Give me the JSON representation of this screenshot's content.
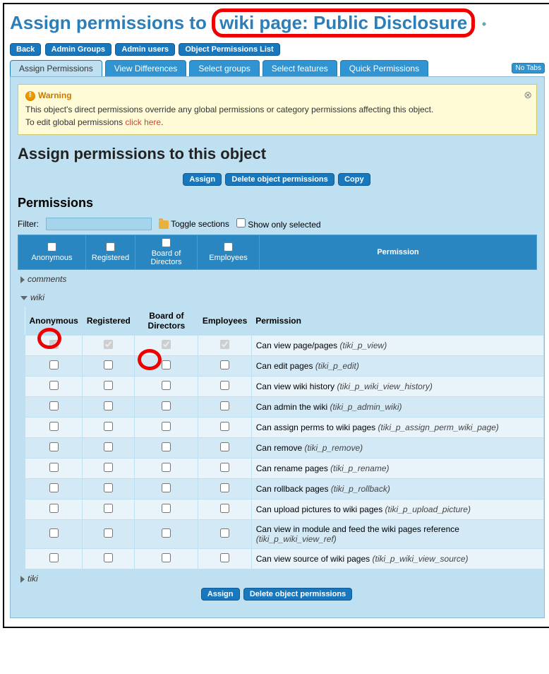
{
  "title_prefix": "Assign permissions to ",
  "title_highlight": "wiki page: Public Disclosure",
  "nav": [
    "Back",
    "Admin Groups",
    "Admin users",
    "Object Permissions List"
  ],
  "tabs": [
    "Assign Permissions",
    "View Differences",
    "Select groups",
    "Select features",
    "Quick Permissions"
  ],
  "no_tabs": "No Tabs",
  "warning": {
    "label": "Warning",
    "line1": "This object's direct permissions override any global permissions or category permissions affecting this object.",
    "line2_a": "To edit global permissions ",
    "line2_link": "click here",
    "line2_b": "."
  },
  "h2": "Assign permissions to this object",
  "actions": {
    "assign": "Assign",
    "delete": "Delete object permissions",
    "copy": "Copy"
  },
  "h3": "Permissions",
  "filter_label": "Filter:",
  "toggle_sections": "Toggle sections",
  "show_only": "Show only selected",
  "groups": [
    "Anonymous",
    "Registered",
    "Board of Directors",
    "Employees"
  ],
  "perm_header": "Permission",
  "sections": {
    "comments": "comments",
    "wiki": "wiki",
    "tiki": "tiki"
  },
  "rows": [
    {
      "disabled": true,
      "chk": [
        true,
        true,
        true,
        true
      ],
      "label": "Can view page/pages ",
      "code": "(tiki_p_view)"
    },
    {
      "disabled": false,
      "chk": [
        false,
        false,
        false,
        false
      ],
      "label": "Can edit pages ",
      "code": "(tiki_p_edit)"
    },
    {
      "disabled": false,
      "chk": [
        false,
        false,
        false,
        false
      ],
      "label": "Can view wiki history ",
      "code": "(tiki_p_wiki_view_history)"
    },
    {
      "disabled": false,
      "chk": [
        false,
        false,
        false,
        false
      ],
      "label": "Can admin the wiki ",
      "code": "(tiki_p_admin_wiki)"
    },
    {
      "disabled": false,
      "chk": [
        false,
        false,
        false,
        false
      ],
      "label": "Can assign perms to wiki pages ",
      "code": "(tiki_p_assign_perm_wiki_page)"
    },
    {
      "disabled": false,
      "chk": [
        false,
        false,
        false,
        false
      ],
      "label": "Can remove ",
      "code": "(tiki_p_remove)"
    },
    {
      "disabled": false,
      "chk": [
        false,
        false,
        false,
        false
      ],
      "label": "Can rename pages ",
      "code": "(tiki_p_rename)"
    },
    {
      "disabled": false,
      "chk": [
        false,
        false,
        false,
        false
      ],
      "label": "Can rollback pages ",
      "code": "(tiki_p_rollback)"
    },
    {
      "disabled": false,
      "chk": [
        false,
        false,
        false,
        false
      ],
      "label": "Can upload pictures to wiki pages ",
      "code": "(tiki_p_upload_picture)"
    },
    {
      "disabled": false,
      "chk": [
        false,
        false,
        false,
        false
      ],
      "label": "Can view in module and feed the wiki pages reference ",
      "code": "(tiki_p_wiki_view_ref)"
    },
    {
      "disabled": false,
      "chk": [
        false,
        false,
        false,
        false
      ],
      "label": "Can view source of wiki pages ",
      "code": "(tiki_p_wiki_view_source)"
    }
  ]
}
